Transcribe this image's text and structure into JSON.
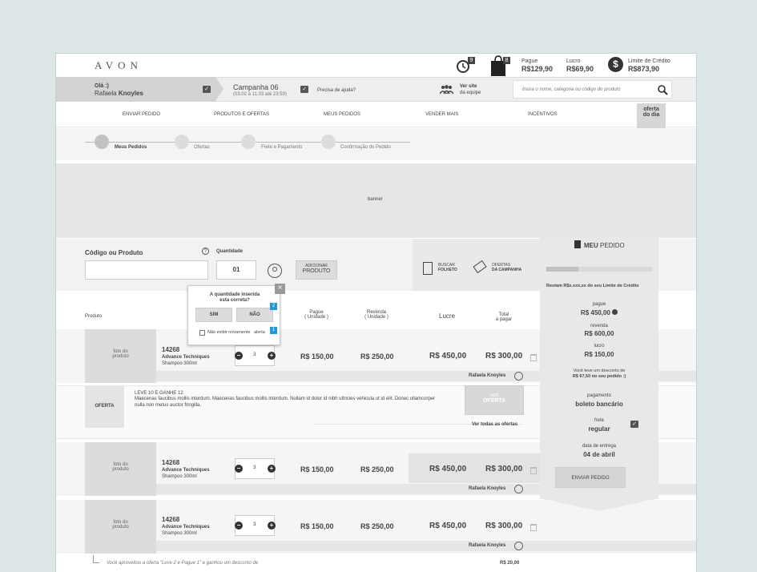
{
  "header": {
    "logo": "AVON",
    "history_count": "9",
    "bag_count": "8",
    "pague_label": "Pague",
    "pague_value": "R$129,90",
    "lucro_label": "Lucro",
    "lucro_value": "R$69,90",
    "limite_label": "Limite de Crédito",
    "limite_value": "R$873,90"
  },
  "user": {
    "greeting": "Olá :)",
    "first_name": "Rafaela",
    "last_name": "Knoyles",
    "campanha": "Campanha 06",
    "campanha_dates": "(03.02 à 11.03 até 23:59)",
    "help": "Precisa de ajuda?",
    "ver_site": "Ver site",
    "da_equipe": "da equipe",
    "search_placeholder": "Insira o nome, categoria ou código do produto"
  },
  "nav": {
    "items": [
      "ENVIAR PEDIDO",
      "PRODUTOS E OFERTAS",
      "MEUS PEDIDOS",
      "VENDER MAIS",
      "INCENTIVOS"
    ],
    "oferta_line1": "oferta",
    "oferta_line2": "do dia"
  },
  "steps": [
    "Meus Pedidos",
    "Ofertas",
    "Frete e Pagamento",
    "Confirmação do Pedido"
  ],
  "banner": "banner",
  "form": {
    "codigo_label": "Código ou Produto",
    "help_icon": "?",
    "quantidade_label": "Quantidade",
    "quantidade_value": "01",
    "adicionar_line1": "ADICIONAR",
    "adicionar_line2": "PRODUTO",
    "buscar_line1": "BUSCAR",
    "buscar_line2": "FOLHETO",
    "ofertas_line1": "OFERTAS",
    "ofertas_line2": "DA CAMPANHA"
  },
  "popup": {
    "question_line1": "A quantidade inserida",
    "question_line2": "esta correta?",
    "sim": "SIM",
    "nao": "NÃO",
    "badge1": "1",
    "badge2": "2",
    "nao_exibir": "Não exibir novamente",
    "alerta": "alerta",
    "close": "×"
  },
  "table": {
    "produto": "Produto",
    "pague_l1": "Pague",
    "pague_l2": "( Unidade )",
    "revenda_l1": "Revenda",
    "revenda_l2": "( Unidade )",
    "lucre": "Lucre",
    "total_l1": "Total",
    "total_l2": "à pagar"
  },
  "rows": [
    {
      "photo_l1": "foto do",
      "photo_l2": "produto",
      "code": "14268",
      "name": "Advance Techniques",
      "desc": "Shampoo 300ml",
      "qty": "3",
      "pague": "R$ 150,00",
      "revenda": "R$ 250,00",
      "lucre": "R$ 450,00",
      "total": "R$ 300,00",
      "user": "Rafaela Knoyles"
    },
    {
      "photo_l1": "foto do",
      "photo_l2": "produto",
      "code": "14268",
      "name": "Advance Techniques",
      "desc": "Shampoo 300ml",
      "qty": "3",
      "pague": "R$ 150,00",
      "revenda": "R$ 250,00",
      "lucre": "R$ 450,00",
      "total": "R$ 300,00",
      "user": "Rafaela Knoyles"
    },
    {
      "photo_l1": "foto do",
      "photo_l2": "produto",
      "code": "14268",
      "name": "Advance Techniques",
      "desc": "Shampoo 300ml",
      "qty": "3",
      "pague": "R$ 150,00",
      "revenda": "R$ 250,00",
      "lucre": "R$ 450,00",
      "total": "R$ 300,00",
      "user": "Rafaela Knoyles"
    }
  ],
  "oferta": {
    "label": "OFERTA",
    "title": "LEVE 10 E GANHE 12",
    "text": "Maecenas faucibus mollis interdum. Maecenas faucibus mollis interdum. Nullam id dolor id nibh ultricies vehicula ut id elit. Donec ullamcorper nulla non metus auctor fringilla.",
    "ver": "VER",
    "ver_oferta": "OFERTA",
    "ver_todas": "Ver todas as ofertas"
  },
  "footer_note": "Você aproveitou a oferta \"Leve 2 e Pague 1\" e ganhou um desconto de",
  "footer_value": "R$ 20,00",
  "side": {
    "meu": "MEU",
    "pedido": "PEDIDO",
    "restam": "Restam R$x.xxx,xx do seu Limite de Crédito",
    "pague_label": "pague",
    "pague_value": "R$ 450,00",
    "revenda_label": "revenda",
    "revenda_value": "R$ 600,00",
    "lucro_label": "lucro",
    "lucro_value": "R$ 150,00",
    "desconto_l1": "Você teve um desconto de",
    "desconto_l2": "R$ 67,50 no seu pedido :)",
    "pagamento_label": "pagamento",
    "pagamento_value": "boleto bancário",
    "frete_label": "frete",
    "frete_value": "regular",
    "entrega_label": "data de entrega",
    "entrega_value": "04 de abril",
    "enviar": "ENVIAR PEDIDO"
  }
}
